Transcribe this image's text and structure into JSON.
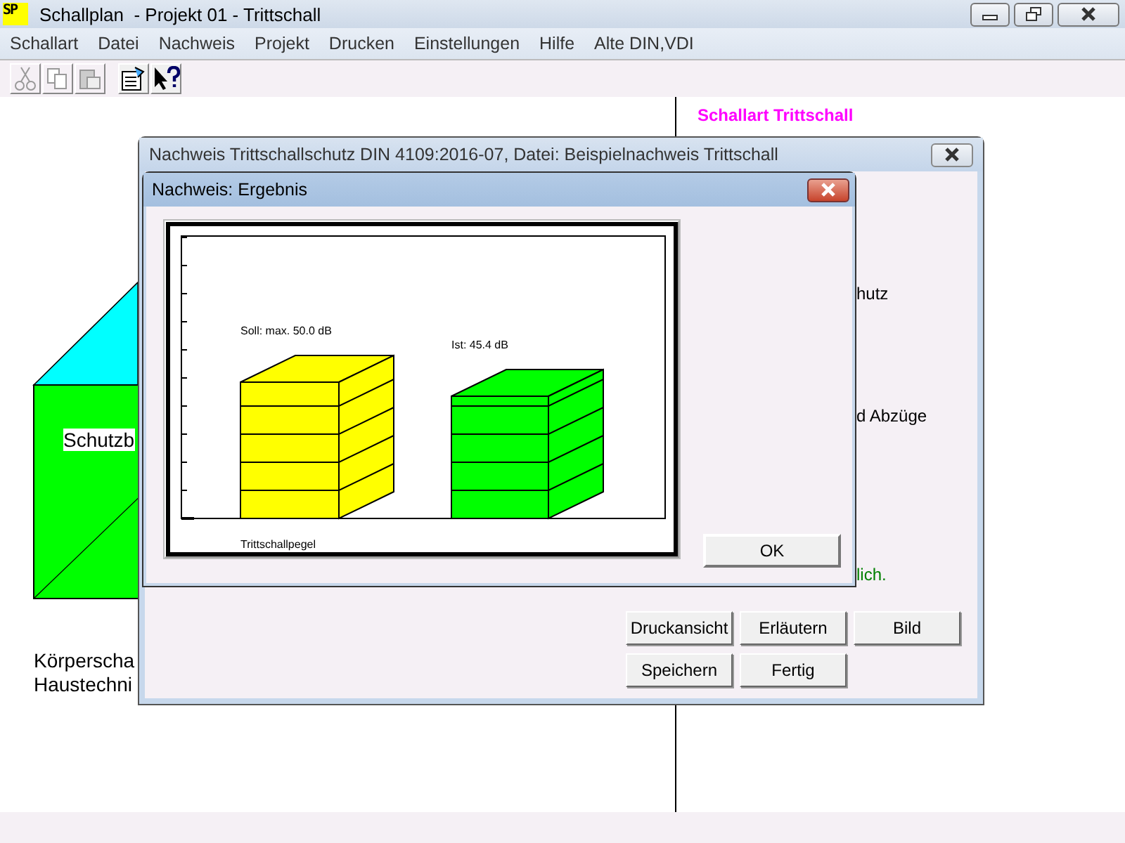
{
  "window": {
    "title": "Schallplan  - Projekt 01 - Trittschall",
    "logo": "SP"
  },
  "menu": [
    "Schallart",
    "Datei",
    "Nachweis",
    "Projekt",
    "Drucken",
    "Einstellungen",
    "Hilfe",
    "Alte DIN,VDI"
  ],
  "toolbar": [
    {
      "kind": "cut",
      "disabled": true
    },
    {
      "kind": "copy",
      "disabled": true
    },
    {
      "kind": "paste",
      "disabled": true
    },
    {
      "kind": "properties",
      "disabled": false
    },
    {
      "kind": "help",
      "disabled": false
    }
  ],
  "canvas": {
    "heading": "Schallart Trittschall",
    "block_label": "Schutzb",
    "notes": [
      "Körperscha",
      "Haustechni"
    ]
  },
  "dialog": {
    "title": "Nachweis Trittschallschutz DIN 4109:2016-07, Datei: Beispielnachweis Trittschall",
    "side_texts": [
      {
        "text": "hutz",
        "kind": "normal"
      },
      {
        "text": "d Abzüge",
        "kind": "normal"
      },
      {
        "text": "lich.",
        "kind": "ok"
      }
    ],
    "buttons": [
      [
        "Druckansicht",
        "Erläutern",
        "Bild"
      ],
      [
        "Speichern",
        "Fertig"
      ]
    ]
  },
  "result": {
    "title": "Nachweis: Ergebnis",
    "bars": [
      {
        "label": "Soll: max. 50.0 dB",
        "color": "#ffff00"
      },
      {
        "label": "Ist: 45.4 dB",
        "color": "#00ff00"
      }
    ],
    "axis_label": "Trittschallpegel",
    "button": "OK"
  }
}
